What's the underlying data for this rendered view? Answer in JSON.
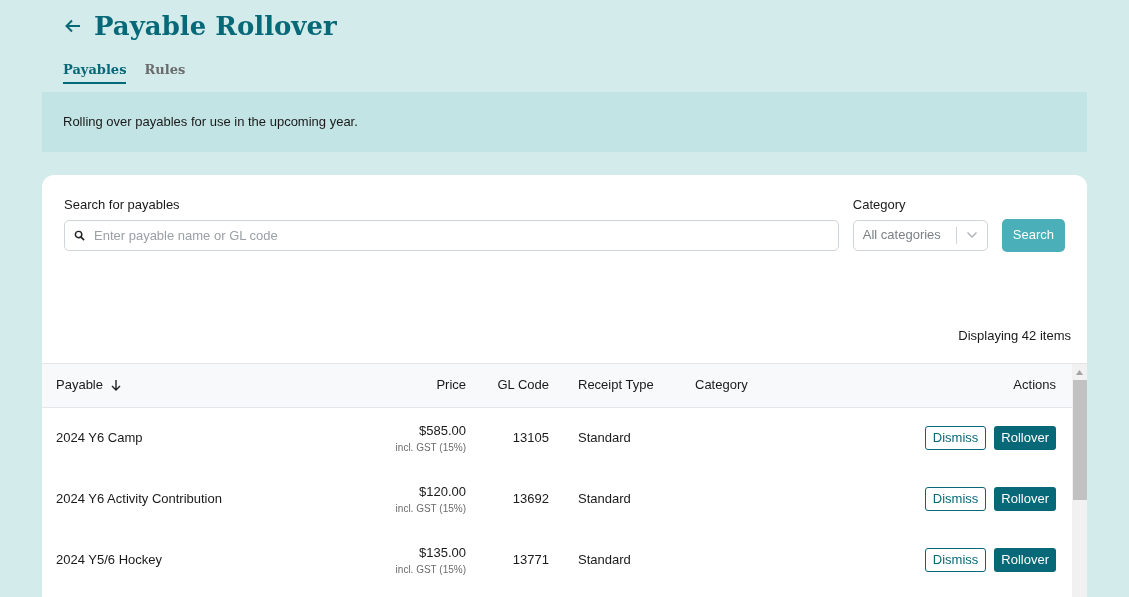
{
  "page": {
    "title": "Payable Rollover"
  },
  "tabs": [
    {
      "label": "Payables",
      "selected": true
    },
    {
      "label": "Rules",
      "selected": false
    }
  ],
  "info_banner": "Rolling over payables for use in the upcoming year.",
  "filters": {
    "search": {
      "label": "Search for payables",
      "placeholder": "Enter payable name or GL code"
    },
    "category": {
      "label": "Category",
      "value": "All categories"
    },
    "search_button": "Search"
  },
  "item_count": "Displaying 42 items",
  "table": {
    "columns": [
      "Payable",
      "Price",
      "GL Code",
      "Receipt Type",
      "Category",
      "Actions"
    ],
    "rows": [
      {
        "payable": "2024 Y6 Camp",
        "price": "$585.00",
        "tax_note": "incl. GST (15%)",
        "gl_code": "13105",
        "receipt_type": "Standard",
        "actions": [
          "Dismiss",
          "Rollover"
        ]
      },
      {
        "payable": "2024 Y6 Activity Contribution",
        "price": "$120.00",
        "tax_note": "incl. GST (15%)",
        "gl_code": "13692",
        "receipt_type": "Standard",
        "actions": [
          "Dismiss",
          "Rollover"
        ]
      },
      {
        "payable": "2024 Y5/6 Hockey",
        "price": "$135.00",
        "tax_note": "incl. GST (15%)",
        "gl_code": "13771",
        "receipt_type": "Standard",
        "actions": [
          "Dismiss",
          "Rollover"
        ]
      }
    ]
  }
}
